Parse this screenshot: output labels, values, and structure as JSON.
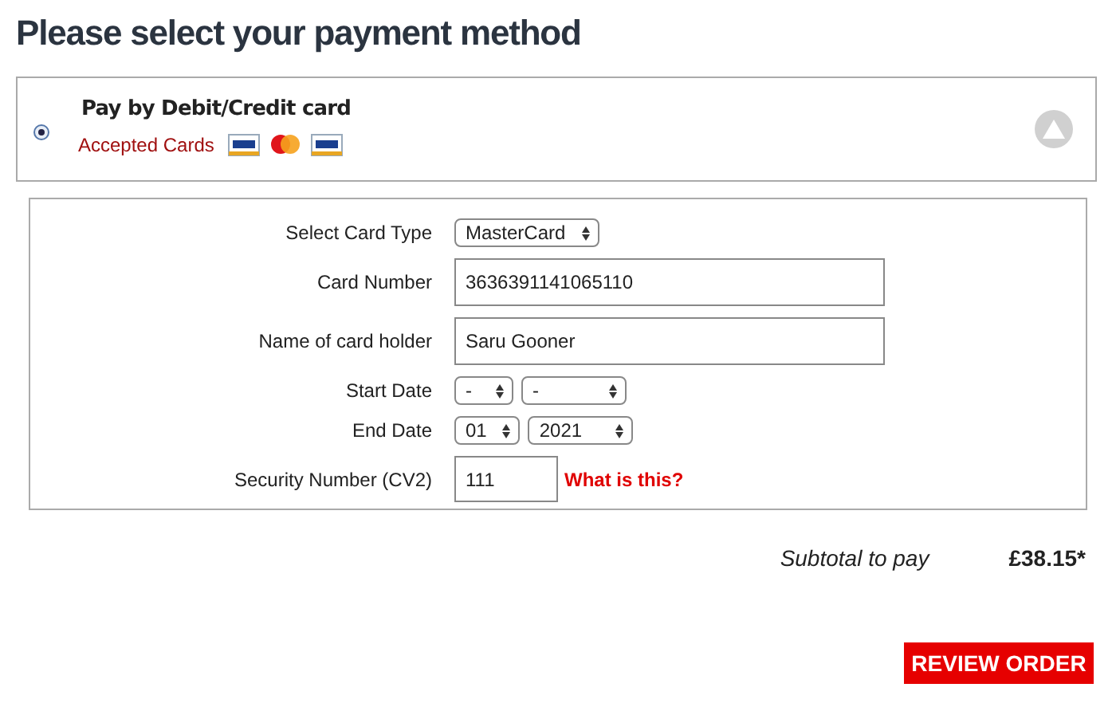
{
  "title": "Please select your payment method",
  "payment_option": {
    "label": "Pay by Debit/Credit card",
    "selected": true,
    "accepted_label": "Accepted Cards",
    "expanded": true
  },
  "fields": [
    {
      "kind": "select",
      "label": "Select Card Type",
      "values": [
        "MasterCard"
      ]
    },
    {
      "kind": "text",
      "label": "Card Number",
      "value": "3636391141065110"
    },
    {
      "kind": "text",
      "label": "Name of card holder",
      "value": "Saru Gooner"
    },
    {
      "kind": "select",
      "label": "Start Date",
      "values": [
        "-",
        "-"
      ]
    },
    {
      "kind": "select",
      "label": "End Date",
      "values": [
        "01",
        "2021"
      ]
    },
    {
      "kind": "short_text",
      "label": "Security Number (CV2)",
      "value": "111",
      "link": "What is this?"
    }
  ],
  "subtotal": {
    "label": "Subtotal to pay",
    "amount": "£38.15*"
  },
  "button": "REVIEW ORDER"
}
